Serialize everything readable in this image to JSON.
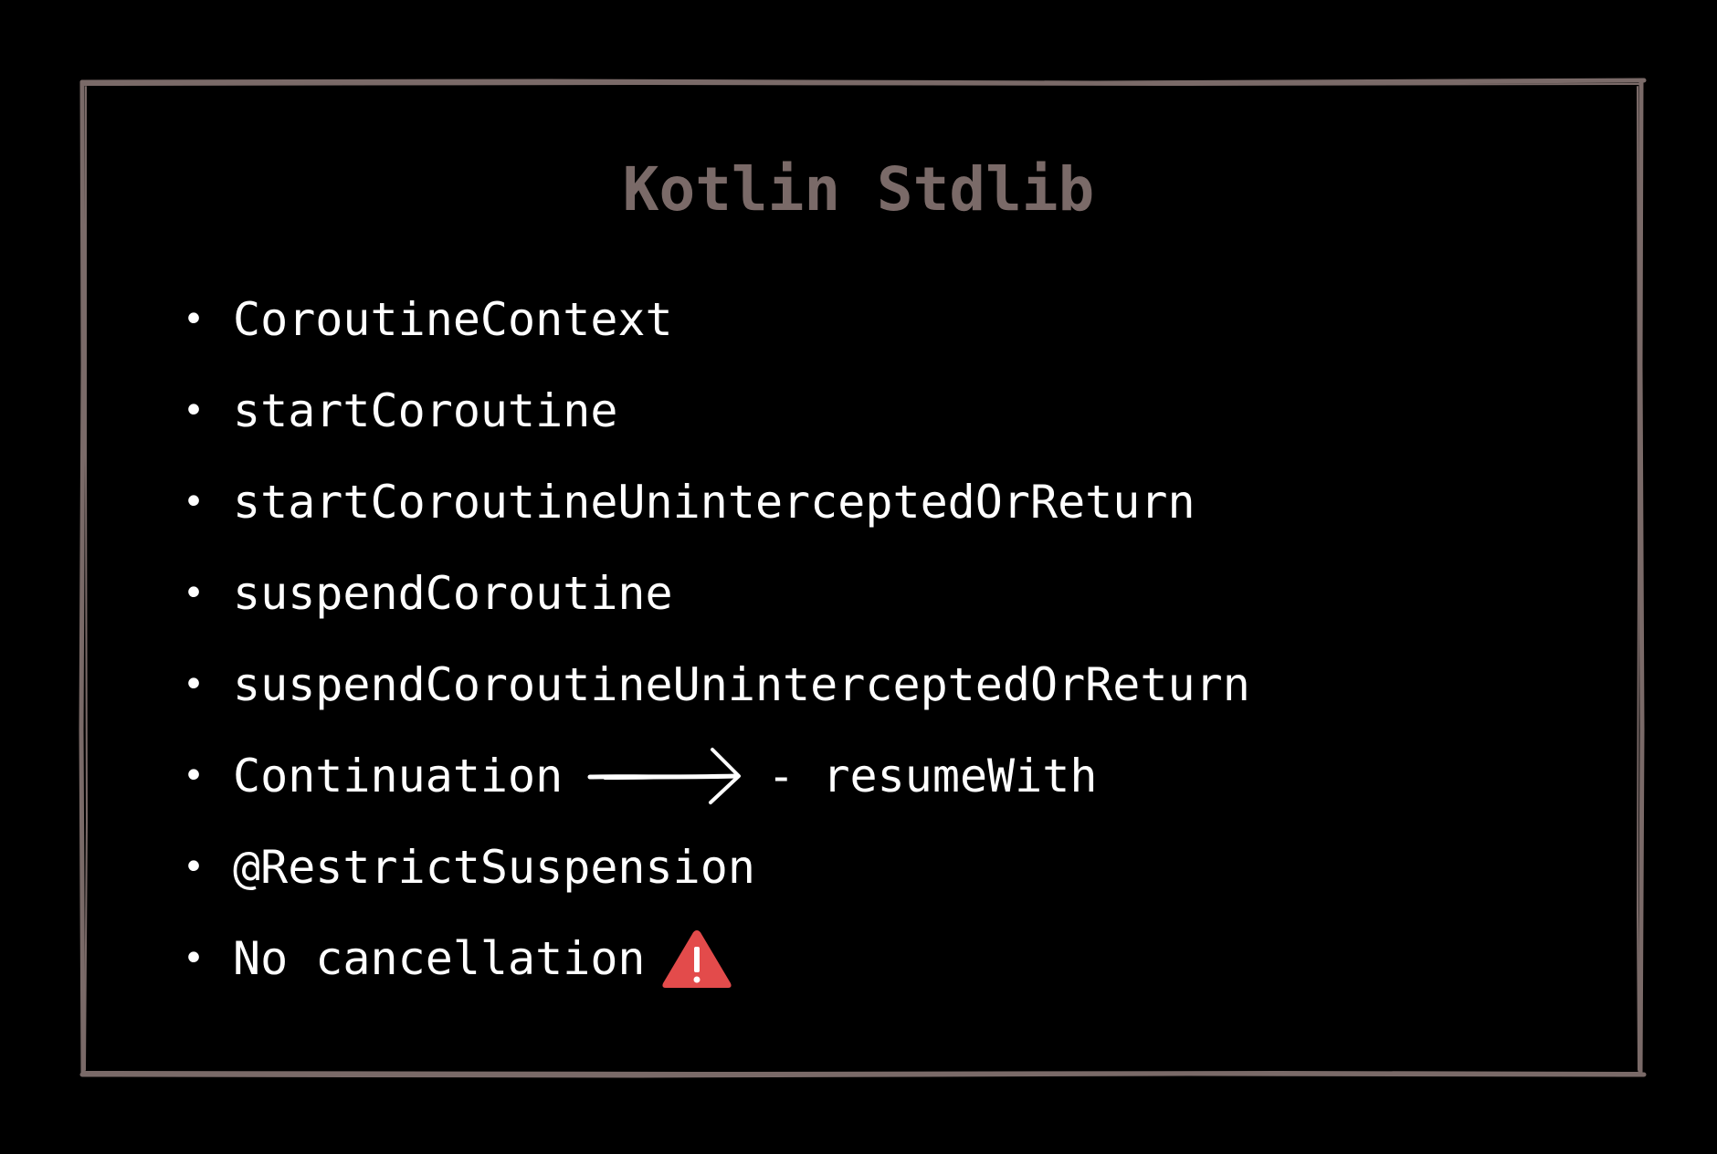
{
  "slide": {
    "title": "Kotlin Stdlib",
    "frame_color": "#7a6a68",
    "items": [
      {
        "text": "CoroutineContext"
      },
      {
        "text": "startCoroutine"
      },
      {
        "text": "startCoroutineUninterceptedOrReturn"
      },
      {
        "text": "suspendCoroutine"
      },
      {
        "text": "suspendCoroutineUninterceptedOrReturn"
      },
      {
        "text": "Continuation",
        "arrow_icon": "right-arrow-icon",
        "suffix": "- resumeWith"
      },
      {
        "text": "@RestrictSuspension"
      },
      {
        "text": "No cancellation",
        "trailing_icon": "warning-icon",
        "icon_color": "#e34b4b"
      }
    ]
  }
}
